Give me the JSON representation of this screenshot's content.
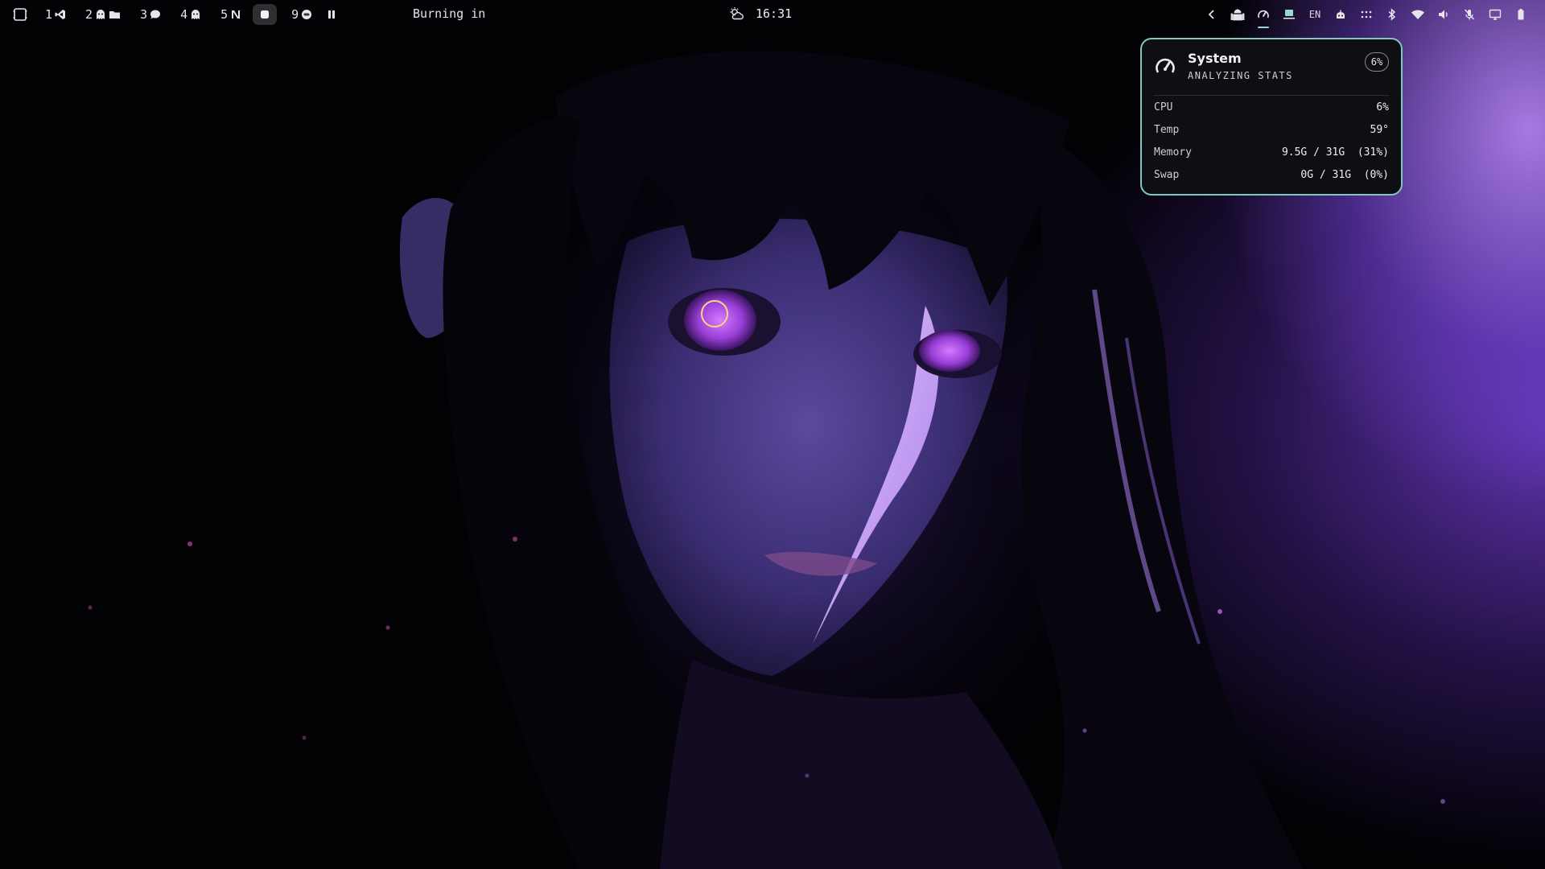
{
  "topbar": {
    "workspaces": [
      {
        "number": "1",
        "icon": "vscode-icon"
      },
      {
        "number": "2",
        "icon": "ghost-icon"
      },
      {
        "number": "3",
        "icon": "chat-bubble-icon"
      },
      {
        "number": "4",
        "icon": "ghost-icon"
      },
      {
        "number": "5",
        "icon": "notion-icon"
      },
      {
        "number": "",
        "icon": "square-icon",
        "active": true
      },
      {
        "number": "9",
        "icon": "app-circle-icon"
      }
    ],
    "media_title": "Burning in",
    "clock": "16:31",
    "weather_icon": "partly-cloudy-icon",
    "language": "EN"
  },
  "system_popup": {
    "title": "System",
    "subtitle": "ANALYZING STATS",
    "badge": "6%",
    "rows": [
      {
        "label": "CPU",
        "value": "6%"
      },
      {
        "label": "Temp",
        "value": "59°"
      },
      {
        "label": "Memory",
        "value": "9.5G / 31G  (31%)"
      },
      {
        "label": "Swap",
        "value": "0G / 31G  (0%)"
      }
    ]
  },
  "colors": {
    "accent": "#7fc8c2",
    "popup_bg": "#0f0e12",
    "wallpaper_glow": "#9b6bff"
  }
}
